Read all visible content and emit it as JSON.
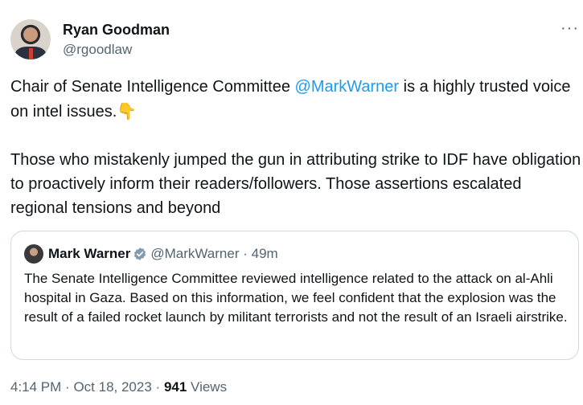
{
  "author": {
    "name": "Ryan Goodman",
    "handle": "@rgoodlaw"
  },
  "more_icon": "more-horizontal-icon",
  "tweet": {
    "p1_before": "Chair of Senate Intelligence Committee ",
    "p1_mention": "@MarkWarner",
    "p1_after": " is a highly trusted voice on intel issues.",
    "p1_emoji": "👇",
    "p2": "Those who mistakenly jumped the gun in attributing strike to IDF have obligation to proactively inform their readers/followers. Those assertions escalated regional tensions and beyond"
  },
  "quote": {
    "name": "Mark Warner",
    "verified_icon": "verified-badge-icon",
    "verified_color": "#829aab",
    "handle": "@MarkWarner",
    "separator": "·",
    "time": "49m",
    "text": "The Senate Intelligence Committee reviewed intelligence related to the attack on al-Ahli hospital in Gaza. Based on this information, we feel confident that the explosion was the result of a failed rocket launch by militant terrorists and not the result of an Israeli airstrike."
  },
  "meta": {
    "time": "4:14 PM",
    "sep1": "·",
    "date": "Oct 18, 2023",
    "sep2": "·",
    "views_count": "941",
    "views_label": "Views"
  },
  "colors": {
    "link": "#1d9bf0",
    "secondary_text": "#536471",
    "border": "#cfd9de"
  }
}
